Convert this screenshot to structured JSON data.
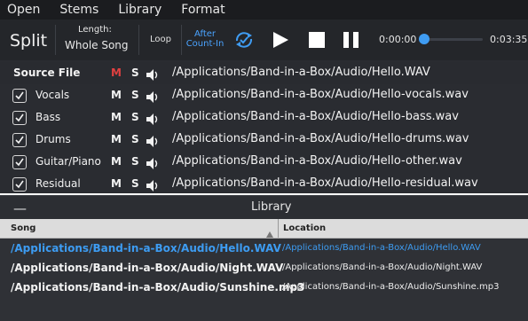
{
  "menubar": {
    "items": [
      "Open",
      "Stems",
      "Library",
      "Format"
    ]
  },
  "toolbar": {
    "title": "Split",
    "length_label": "Length:",
    "length_value": "Whole Song",
    "loop_label": "Loop",
    "after_count_line1": "After",
    "after_count_line2": "Count-In",
    "time_start": "0:00:00",
    "time_end": "0:03:35",
    "progress_fraction": 0.0,
    "icons": [
      "sync-check-icon",
      "play-icon",
      "stop-icon",
      "pause-icon"
    ],
    "accent_color": "#3f9cf2"
  },
  "stems": {
    "source": {
      "label": "Source File",
      "mute": "M",
      "solo": "S",
      "path": "/Applications/Band-in-a-Box/Audio/Hello.WAV",
      "mute_color": "#e04040"
    },
    "rows": [
      {
        "name": "Vocals",
        "mute": "M",
        "solo": "S",
        "path": "/Applications/Band-in-a-Box/Audio/Hello-vocals.wav",
        "checked": true
      },
      {
        "name": "Bass",
        "mute": "M",
        "solo": "S",
        "path": "/Applications/Band-in-a-Box/Audio/Hello-bass.wav",
        "checked": true
      },
      {
        "name": "Drums",
        "mute": "M",
        "solo": "S",
        "path": "/Applications/Band-in-a-Box/Audio/Hello-drums.wav",
        "checked": true
      },
      {
        "name": "Guitar/Piano",
        "mute": "M",
        "solo": "S",
        "path": "/Applications/Band-in-a-Box/Audio/Hello-other.wav",
        "checked": true
      },
      {
        "name": "Residual",
        "mute": "M",
        "solo": "S",
        "path": "/Applications/Band-in-a-Box/Audio/Hello-residual.wav",
        "checked": true
      }
    ]
  },
  "library": {
    "collapse_label": "—",
    "title": "Library",
    "columns": {
      "song": "Song",
      "location": "Location"
    },
    "rows": [
      {
        "song": "/Applications/Band-in-a-Box/Audio/Hello.WAV",
        "location": "/Applications/Band-in-a-Box/Audio/Hello.WAV",
        "selected": true
      },
      {
        "song": "/Applications/Band-in-a-Box/Audio/Night.WAV",
        "location": "/Applications/Band-in-a-Box/Audio/Night.WAV",
        "selected": false
      },
      {
        "song": "/Applications/Band-in-a-Box/Audio/Sunshine.mp3",
        "location": "/Applications/Band-in-a-Box/Audio/Sunshine.mp3",
        "selected": false
      }
    ],
    "selected_color": "#3d9cf2"
  }
}
